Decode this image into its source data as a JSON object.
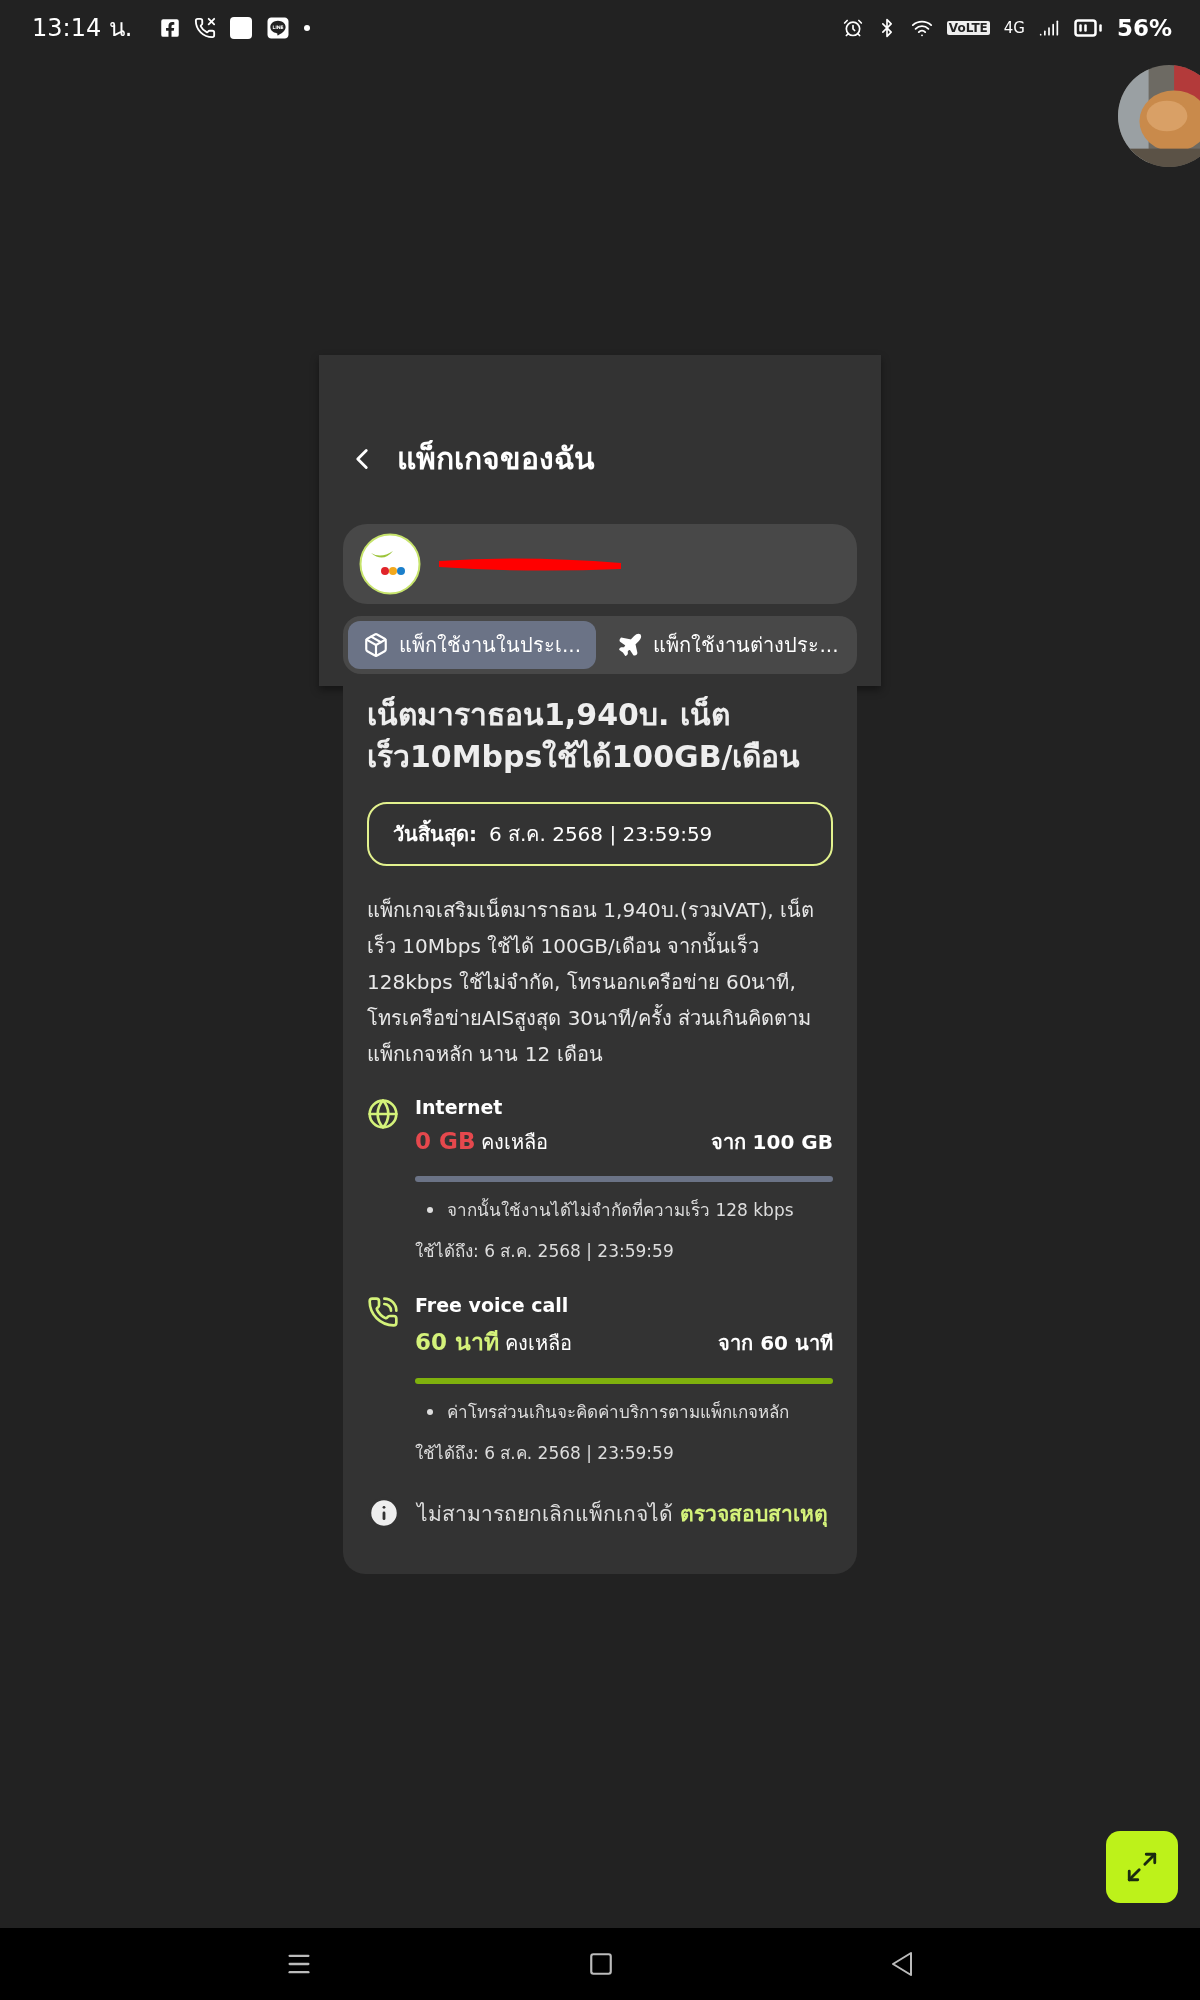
{
  "status_bar": {
    "time": "13:14 น.",
    "volte": "VoLTE",
    "network": "4G",
    "battery": "56%"
  },
  "header": {
    "title": "แพ็กเกจของฉัน"
  },
  "tabs": [
    {
      "label": "แพ็กใช้งานในประเ...",
      "kind": "domestic",
      "selected": true
    },
    {
      "label": "แพ็กใช้งานต่างประ...",
      "kind": "roaming",
      "selected": false
    }
  ],
  "package": {
    "title": "เน็ตมาราธอน1,940บ. เน็ต เร็ว10Mbpsใช้ได้100GB/เดือน",
    "expiry_label": "วันสิ้นสุด:",
    "expiry_value": "6 ส.ค. 2568 | 23:59:59",
    "description": "แพ็กเกจเสริมเน็ตมาราธอน 1,940บ.(รวมVAT), เน็ตเร็ว 10Mbps ใช้ได้ 100GB/เดือน จากนั้นเร็ว 128kbps ใช้ไม่จำกัด, โทรนอกเครือข่าย 60นาที, โทรเครือข่ายAISสูงสุด 30นาที/ครั้ง ส่วนเกินคิดตามแพ็กเกจหลัก นาน 12 เดือน",
    "quotas": [
      {
        "kind": "internet",
        "title": "Internet",
        "remaining": "0 GB",
        "remaining_label": "คงเหลือ",
        "total": "จาก 100 GB",
        "exhausted": true,
        "note": "จากนั้นใช้งานได้ไม่จำกัดที่ความเร็ว 128 kbps",
        "valid_until": "ใช้ได้ถึง: 6 ส.ค. 2568 | 23:59:59"
      },
      {
        "kind": "voice",
        "title": "Free voice call",
        "remaining": "60 นาที",
        "remaining_label": "คงเหลือ",
        "total": "จาก 60 นาที",
        "exhausted": false,
        "note": "ค่าโทรส่วนเกินจะคิดค่าบริการตามแพ็กเกจหลัก",
        "valid_until": "ใช้ได้ถึง: 6 ส.ค. 2568 | 23:59:59"
      }
    ],
    "notice": {
      "text": "ไม่สามารถยกเลิกแพ็กเกจได้",
      "link": "ตรวจสอบสาเหตุ"
    }
  }
}
